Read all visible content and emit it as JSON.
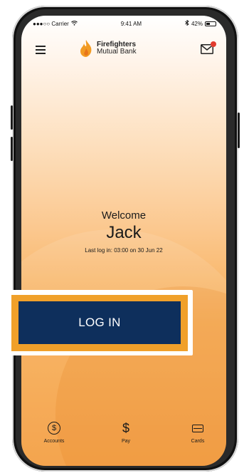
{
  "status_bar": {
    "carrier": "●●●○○ Carrier",
    "time": "9:41 AM",
    "battery": "42%",
    "battery_level": 0.42
  },
  "header": {
    "brand_line1": "Firefighters",
    "brand_line2": "Mutual Bank"
  },
  "welcome": {
    "label": "Welcome",
    "name": "Jack",
    "last_login": "Last log in: 03:00 on 30 Jun 22"
  },
  "login_button": {
    "label": "LOG IN"
  },
  "tabs": [
    {
      "label": "Accounts",
      "icon": "dollar-circle-icon"
    },
    {
      "label": "Pay",
      "icon": "dollar-icon"
    },
    {
      "label": "Cards",
      "icon": "card-icon"
    }
  ],
  "colors": {
    "primary": "#0e2f5c",
    "accent": "#f0a02a",
    "notification": "#e23b2e"
  }
}
